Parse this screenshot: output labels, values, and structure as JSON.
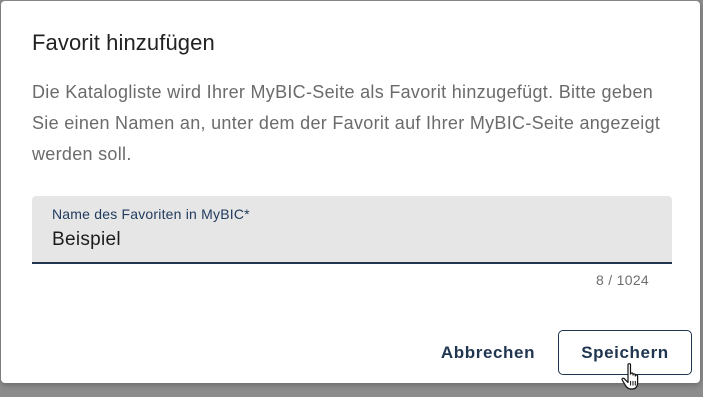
{
  "dialog": {
    "title": "Favorit hinzufügen",
    "description": "Die Katalogliste wird Ihrer MyBIC-Seite als Favorit hinzugefügt. Bitte geben Sie einen Namen an, unter dem der Favorit auf Ihrer MyBIC-Seite angezeigt werden soll.",
    "field": {
      "label": "Name des Favoriten in MyBIC*",
      "value": "Beispiel",
      "counter": "8 / 1024"
    },
    "buttons": {
      "cancel_label": "Abbrechen",
      "save_label": "Speichern"
    }
  },
  "colors": {
    "accent": "#1f3550",
    "field_background": "#e6e6e6",
    "backdrop": "#8c8c8c"
  },
  "icons": {
    "cursor": "hand-pointer-cursor-icon"
  }
}
